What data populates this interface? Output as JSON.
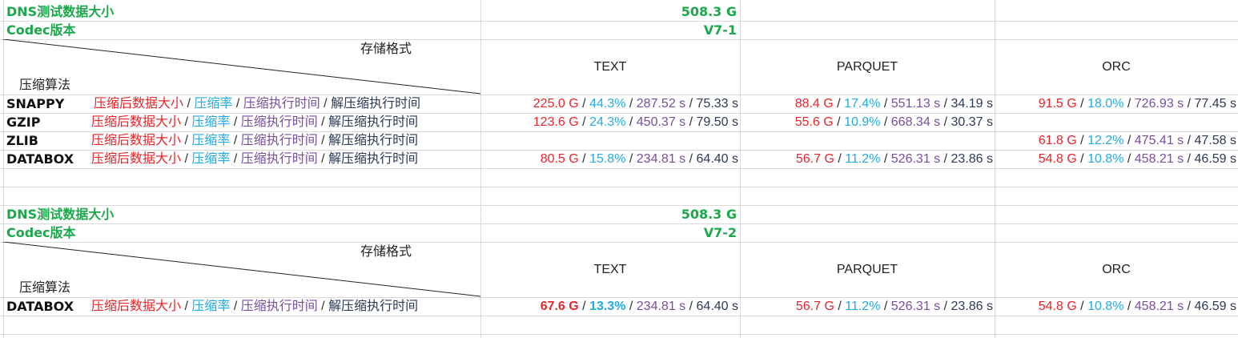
{
  "block1": {
    "title_label": "DNS测试数据大小",
    "title_value": "508.3 G",
    "codec_label": "Codec版本",
    "codec_value": "V7-1",
    "header_storage": "存储格式",
    "header_algo": "压缩算法",
    "formats": [
      "TEXT",
      "PARQUET",
      "ORC"
    ],
    "rows": [
      {
        "algo": "SNAPPY",
        "text": {
          "size": "225.0 G",
          "ratio": "44.3%",
          "ctime": "287.52 s",
          "dtime": "75.33 s"
        },
        "parquet": {
          "size": "88.4 G",
          "ratio": "17.4%",
          "ctime": "551.13 s",
          "dtime": "34.19 s"
        },
        "orc": {
          "size": "91.5 G",
          "ratio": "18.0%",
          "ctime": "726.93 s",
          "dtime": "77.45 s"
        }
      },
      {
        "algo": "GZIP",
        "text": {
          "size": "123.6 G",
          "ratio": "24.3%",
          "ctime": "450.37 s",
          "dtime": "79.50 s"
        },
        "parquet": {
          "size": "55.6 G",
          "ratio": "10.9%",
          "ctime": "668.34 s",
          "dtime": "30.37 s"
        }
      },
      {
        "algo": "ZLIB",
        "orc": {
          "size": "61.8 G",
          "ratio": "12.2%",
          "ctime": "475.41 s",
          "dtime": "47.58 s"
        }
      },
      {
        "algo": "DATABOX",
        "text": {
          "size": "80.5 G",
          "ratio": "15.8%",
          "ctime": "234.81 s",
          "dtime": "64.40 s"
        },
        "parquet": {
          "size": "56.7 G",
          "ratio": "11.2%",
          "ctime": "526.31 s",
          "dtime": "23.86 s"
        },
        "orc": {
          "size": "54.8 G",
          "ratio": "10.8%",
          "ctime": "458.21 s",
          "dtime": "46.59 s"
        }
      }
    ]
  },
  "block2": {
    "title_label": "DNS测试数据大小",
    "title_value": "508.3 G",
    "codec_label": "Codec版本",
    "codec_value": "V7-2",
    "header_storage": "存储格式",
    "header_algo": "压缩算法",
    "formats": [
      "TEXT",
      "PARQUET",
      "ORC"
    ],
    "rows": [
      {
        "algo": "DATABOX",
        "text": {
          "size": "67.6 G",
          "ratio": "13.3%",
          "ctime": "234.81 s",
          "dtime": "64.40 s"
        },
        "parquet": {
          "size": "56.7 G",
          "ratio": "11.2%",
          "ctime": "526.31 s",
          "dtime": "23.86 s"
        },
        "orc": {
          "size": "54.8 G",
          "ratio": "10.8%",
          "ctime": "458.21 s",
          "dtime": "46.59 s"
        }
      }
    ]
  },
  "legend": {
    "size": "压缩后数据大小",
    "ratio": "压缩率",
    "ctime": "压缩执行时间",
    "dtime": "解压缩执行时间",
    "sep": " / "
  },
  "colors": {
    "green": "#1aa84a",
    "size": "#e8262a",
    "ratio": "#27a9e1",
    "ctime": "#7a4e9e",
    "dtime": "#2b3a55",
    "grid": "#d9d9d9"
  }
}
